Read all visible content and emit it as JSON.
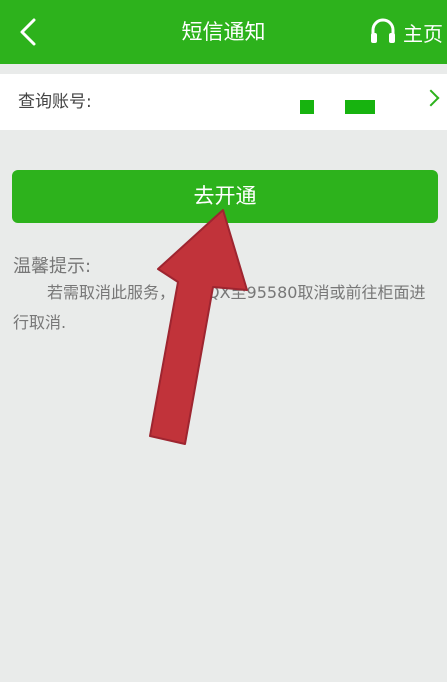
{
  "header": {
    "title": "短信通知",
    "home_label": "主页",
    "back_icon": "chevron-left-icon",
    "home_icon": "headset-icon"
  },
  "account": {
    "label": "查询账号:"
  },
  "open_button": {
    "label": "去开通"
  },
  "tip": {
    "title": "温馨提示:",
    "text": "若需取消此服务，编辑QX至95580取消或前往柜面进行取消."
  },
  "colors": {
    "header_green": "#2db21c",
    "page_background": "#e9ebea",
    "arrow_red": "#c1333a",
    "mask_green": "#17b30f"
  }
}
